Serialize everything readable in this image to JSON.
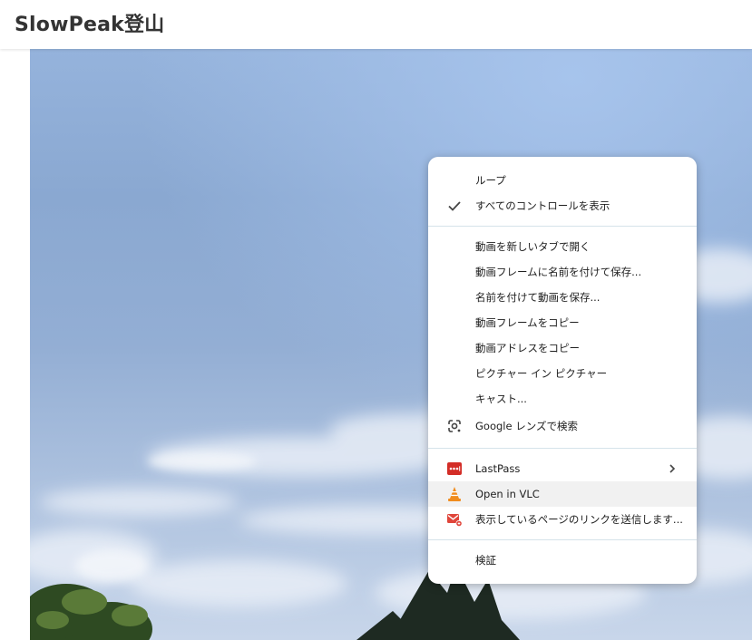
{
  "site": {
    "title": "SlowPeak登山"
  },
  "context_menu": {
    "items": [
      {
        "label": "ループ",
        "icon": "none",
        "checked": false
      },
      {
        "label": "すべてのコントロールを表示",
        "icon": "checkmark-icon",
        "checked": true
      },
      {
        "label": "動画を新しいタブで開く",
        "icon": "none"
      },
      {
        "label": "動画フレームに名前を付けて保存...",
        "icon": "none"
      },
      {
        "label": "名前を付けて動画を保存...",
        "icon": "none"
      },
      {
        "label": "動画フレームをコピー",
        "icon": "none"
      },
      {
        "label": "動画アドレスをコピー",
        "icon": "none"
      },
      {
        "label": "ピクチャー イン ピクチャー",
        "icon": "none"
      },
      {
        "label": "キャスト...",
        "icon": "none"
      },
      {
        "label": "Google レンズで検索",
        "icon": "google-lens-icon"
      },
      {
        "label": "LastPass",
        "icon": "lastpass-icon",
        "submenu": true
      },
      {
        "label": "Open in VLC",
        "icon": "vlc-icon",
        "highlighted": true
      },
      {
        "label": "表示しているページのリンクを送信します...",
        "icon": "send-link-mail-icon"
      },
      {
        "label": "検証",
        "icon": "none"
      }
    ]
  },
  "colors": {
    "lastpass_red": "#d32d27",
    "vlc_orange": "#f08c1e",
    "mail_red": "#e0453a",
    "separator": "#d5e3ea",
    "hover_bg": "#f1f1f1"
  }
}
